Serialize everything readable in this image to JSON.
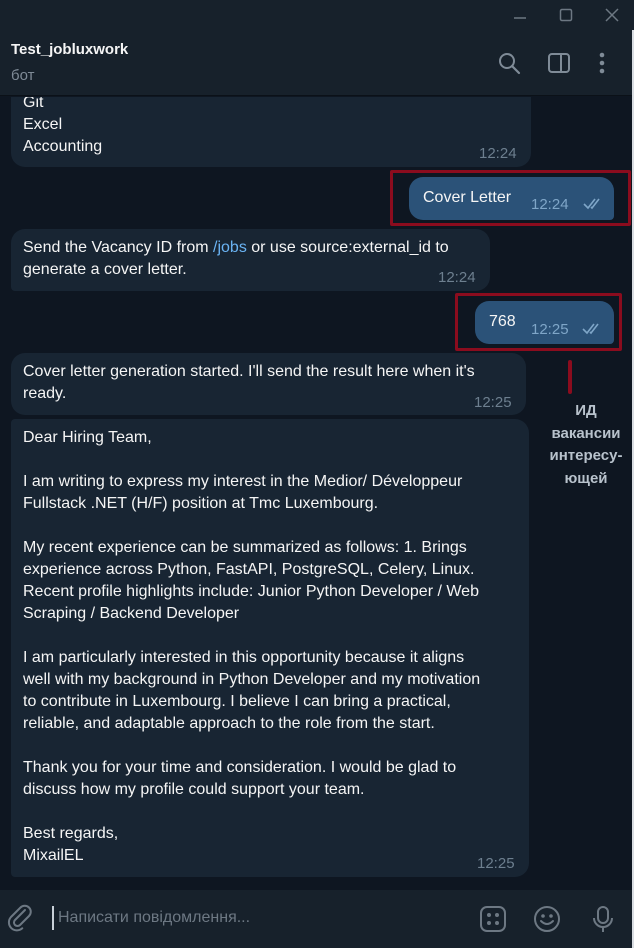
{
  "window": {
    "controls": [
      "minimize-icon",
      "maximize-icon",
      "close-icon"
    ]
  },
  "header": {
    "title": "Test_jobluxwork",
    "subtitle": "бот",
    "icons": [
      "search-icon",
      "sidebar-toggle-icon",
      "more-vert-icon"
    ]
  },
  "messages": [
    {
      "id": "skills",
      "direction": "in",
      "lines": [
        "Git",
        "Excel",
        "Accounting"
      ],
      "time": "12:24"
    },
    {
      "id": "cover-letter",
      "direction": "out",
      "text": "Cover Letter",
      "time": "12:24",
      "status": "read"
    },
    {
      "id": "send-vacancy",
      "direction": "in",
      "text_before": "Send the Vacancy ID from ",
      "link": "/jobs",
      "text_after": " or use source:external_id to\ngenerate a cover letter.",
      "time": "12:24"
    },
    {
      "id": "vacancy-id",
      "direction": "out",
      "text": "768",
      "time": "12:25",
      "status": "read"
    },
    {
      "id": "generation-started",
      "direction": "in",
      "text": "Cover letter generation started. I'll send the result here when it's\nready.",
      "time": "12:25"
    },
    {
      "id": "cover-letter-text",
      "direction": "in",
      "text": "Dear Hiring Team,\n\nI am writing to express my interest in the Medior/ Développeur\nFullstack .NET (H/F) position at Tmc Luxembourg.\n\nMy recent experience can be summarized as follows: 1. Brings\nexperience across Python, FastAPI, PostgreSQL, Celery, Linux.\nRecent profile highlights include: Junior Python Developer / Web\nScraping / Backend Developer\n\nI am particularly interested in this opportunity because it aligns\nwell with my background in Python Developer and my motivation\nto contribute in Luxembourg. I believe I can bring a practical,\nreliable, and adaptable approach to the role from the start.\n\nThank you for your time and consideration. I would be glad to\ndiscuss how my profile could support your team.\n\nBest regards,\nMixailEL",
      "time": "12:25"
    }
  ],
  "annotation": {
    "text": "ИД\nвакансии\nинтересу-\nющей",
    "color": "#8b0c1e"
  },
  "composer": {
    "placeholder": "Написати повідомлення...",
    "icons": [
      "attach-icon",
      "bot-menu-icon",
      "emoji-icon",
      "mic-icon"
    ]
  },
  "colors": {
    "background": "#0e1621",
    "panel": "#17212b",
    "incoming_bubble": "#182533",
    "outgoing_bubble": "#2b5278",
    "link": "#6ab3f3"
  }
}
